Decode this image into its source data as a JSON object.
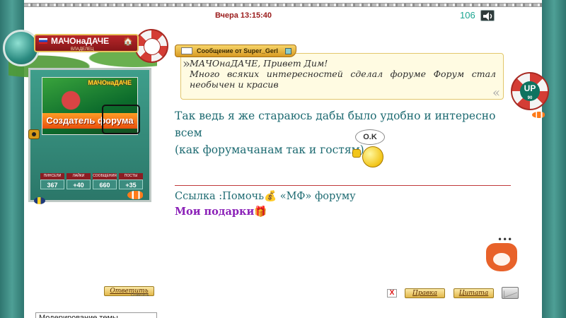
{
  "post": {
    "timestamp": "Вчера 13:15:40",
    "counter": "106"
  },
  "user": {
    "name": "МАЧОнаДАЧЕ",
    "role": "ВЛАДЕЛЕЦ",
    "avatar_title": "МАЧОнаДАЧЕ",
    "avatar_banner": "Создатель форума",
    "stats": [
      {
        "label": "ПИНСЕЛИ",
        "value": "367"
      },
      {
        "label": "ЛАЙКИ",
        "value": "+40"
      },
      {
        "label": "СООБЩЕНИЯ",
        "value": "660"
      },
      {
        "label": "ПОСТЫ",
        "value": "+35"
      }
    ]
  },
  "quote": {
    "header": "Сообщение от Super_Gerl",
    "line1": "МАЧОнаДАЧЕ, Привет Дим!",
    "line2": "Много всяких интересностей сделал форуме  Форум стал",
    "line3": "необычен и красив"
  },
  "up_badge": {
    "label": "UP",
    "count": "90"
  },
  "message": {
    "line1": "Так ведь я же стараюсь дабы было удобно и интересно всем",
    "line2": "(как форумачанам так и гостям)",
    "smiley_text": "O.K"
  },
  "signature": {
    "link_prefix": "Ссылка :Помочь",
    "money_icon": "💰",
    "link_suffix": " «МФ» форуму",
    "gifts": "Мои подарки",
    "gift_icon": "🎁"
  },
  "buttons": {
    "reply": "Ответить",
    "reply_sub": "Ответить",
    "delete": "X",
    "edit": "Правка",
    "quote": "Цитата"
  },
  "moderation": {
    "selected": "Модерирование темы"
  },
  "colors": {
    "background": "#3f8a82",
    "message_text": "#1e6b72",
    "gifts_text": "#8b21b8",
    "divider": "#c0393b",
    "timestamp": "#9a1b1b"
  }
}
